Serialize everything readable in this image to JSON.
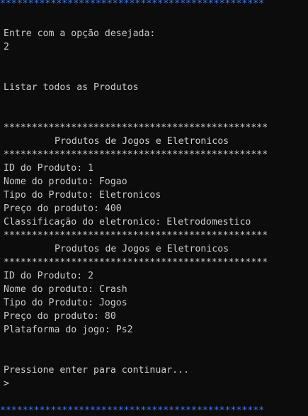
{
  "terminal": {
    "top_banner": "***********************************************",
    "prompt_label": "Entre com a opção desejada:",
    "selected_option": "2",
    "section_title": "Listar todos as Produtos",
    "separator": "***********************************************",
    "products": [
      {
        "header": "Produtos de Jogos e Eletronicos",
        "id_line": "ID do Produto: 1",
        "name_line": "Nome do produto: Fogao",
        "type_line": "Tipo do Produto: Eletronicos",
        "price_line": "Preço do produto: 400",
        "extra_line": "Classificação do eletronico: Eletrodomestico"
      },
      {
        "header": "Produtos de Jogos e Eletronicos",
        "id_line": "ID do Produto: 2",
        "name_line": "Nome do produto: Crash",
        "type_line": "Tipo do Produto: Jogos",
        "price_line": "Preço do produto: 80",
        "extra_line": "Plataforma do jogo: Ps2"
      }
    ],
    "continue_prompt": "Pressione enter para continuar...",
    "cursor_prompt": ">",
    "bottom_banner": "***********************************************"
  },
  "colors": {
    "background": "#0c0c0c",
    "text": "#cccccc",
    "banner": "#3b78ff"
  }
}
